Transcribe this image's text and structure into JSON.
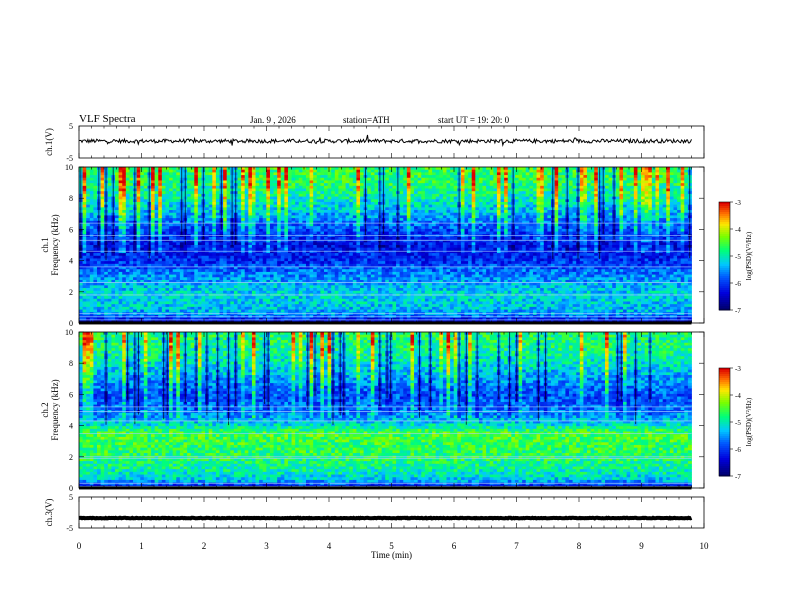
{
  "header": {
    "title": "VLF  Spectra",
    "date": "Jan. 9  , 2026",
    "station": "station=ATH",
    "start": "start  UT  =   19: 20: 0"
  },
  "colors": {
    "ink": "#000000",
    "spectro_low": "#00008b",
    "spectro_mid": "#00ff66",
    "spectro_high": "#ff0000"
  },
  "chart_data": [
    {
      "type": "line",
      "panel": "ch1-waveform",
      "ylabel": "ch.1(V)",
      "ylim": [
        -5,
        5
      ],
      "yticks": [
        {
          "v": 5,
          "label": "5"
        },
        {
          "v": -5,
          "label": "-5"
        }
      ],
      "xlim": [
        0,
        10
      ],
      "x_end": 9.8,
      "baseline": 0.3,
      "noise_amplitude": 0.6,
      "grid": false
    },
    {
      "type": "heatmap",
      "panel": "ch1-spectrogram",
      "ylabel": "ch.1\nFrequency  (kHz)",
      "ylim": [
        0,
        10
      ],
      "yticks": [
        {
          "v": 0,
          "label": "0"
        },
        {
          "v": 2,
          "label": "2"
        },
        {
          "v": 4,
          "label": "4"
        },
        {
          "v": 6,
          "label": "6"
        },
        {
          "v": 8,
          "label": "8"
        },
        {
          "v": 10,
          "label": "10"
        }
      ],
      "xlim": [
        0,
        10
      ],
      "x_end": 9.8,
      "colorbar": {
        "label": "log(PSD)(V²/Hz)",
        "range": [
          -7,
          -3
        ],
        "ticks": [
          "-3",
          "-4",
          "-5",
          "-6",
          "-7"
        ]
      },
      "profile": [
        {
          "f": 0.0,
          "v": -6.8
        },
        {
          "f": 0.5,
          "v": -5.6
        },
        {
          "f": 1.0,
          "v": -5.3
        },
        {
          "f": 1.8,
          "v": -5.2
        },
        {
          "f": 2.5,
          "v": -5.4
        },
        {
          "f": 3.2,
          "v": -5.7
        },
        {
          "f": 4.0,
          "v": -6.1
        },
        {
          "f": 5.0,
          "v": -6.3
        },
        {
          "f": 6.0,
          "v": -5.9
        },
        {
          "f": 7.0,
          "v": -5.4
        },
        {
          "f": 8.0,
          "v": -5.0
        },
        {
          "f": 9.0,
          "v": -4.7
        },
        {
          "f": 10.0,
          "v": -4.6
        }
      ],
      "lines_khz": [
        0.2,
        0.4,
        0.6,
        1.8,
        2.6,
        3.6,
        4.6,
        5.3,
        5.6,
        6.4
      ]
    },
    {
      "type": "heatmap",
      "panel": "ch2-spectrogram",
      "ylabel": "ch.2\nFrequency  (kHz)",
      "ylim": [
        0,
        10
      ],
      "yticks": [
        {
          "v": 0,
          "label": "0"
        },
        {
          "v": 2,
          "label": "2"
        },
        {
          "v": 4,
          "label": "4"
        },
        {
          "v": 6,
          "label": "6"
        },
        {
          "v": 8,
          "label": "8"
        },
        {
          "v": 10,
          "label": "10"
        }
      ],
      "xlim": [
        0,
        10
      ],
      "x_end": 9.8,
      "colorbar": {
        "label": "log(PSD)(V²/Hz)",
        "range": [
          -7,
          -3
        ],
        "ticks": [
          "-3",
          "-4",
          "-5",
          "-6",
          "-7"
        ]
      },
      "profile": [
        {
          "f": 0.0,
          "v": -6.6
        },
        {
          "f": 0.5,
          "v": -5.3
        },
        {
          "f": 1.0,
          "v": -5.0
        },
        {
          "f": 2.0,
          "v": -4.7
        },
        {
          "f": 3.0,
          "v": -4.6
        },
        {
          "f": 3.5,
          "v": -4.5
        },
        {
          "f": 4.2,
          "v": -5.3
        },
        {
          "f": 5.0,
          "v": -5.7
        },
        {
          "f": 6.0,
          "v": -5.9
        },
        {
          "f": 7.0,
          "v": -5.5
        },
        {
          "f": 8.0,
          "v": -5.1
        },
        {
          "f": 9.0,
          "v": -4.8
        },
        {
          "f": 10.0,
          "v": -4.7
        }
      ],
      "lines_khz": [
        0.1,
        0.3,
        1.9,
        2.0,
        3.5,
        4.3,
        4.9,
        5.2
      ]
    },
    {
      "type": "line",
      "panel": "ch3-waveform",
      "ylabel": "ch.3(V)",
      "ylim": [
        -5,
        5
      ],
      "yticks": [
        {
          "v": 5,
          "label": "5"
        },
        {
          "v": -5,
          "label": "-5"
        }
      ],
      "xlim": [
        0,
        10
      ],
      "x_end": 9.8,
      "baseline": -1.8,
      "noise_amplitude": 0.1,
      "xlabel": "Time  (min)",
      "xticks": [
        {
          "v": 0,
          "label": "0"
        },
        {
          "v": 1,
          "label": "1"
        },
        {
          "v": 2,
          "label": "2"
        },
        {
          "v": 3,
          "label": "3"
        },
        {
          "v": 4,
          "label": "4"
        },
        {
          "v": 5,
          "label": "5"
        },
        {
          "v": 6,
          "label": "6"
        },
        {
          "v": 7,
          "label": "7"
        },
        {
          "v": 8,
          "label": "8"
        },
        {
          "v": 9,
          "label": "9"
        },
        {
          "v": 10,
          "label": "10"
        }
      ],
      "grid": false
    }
  ]
}
